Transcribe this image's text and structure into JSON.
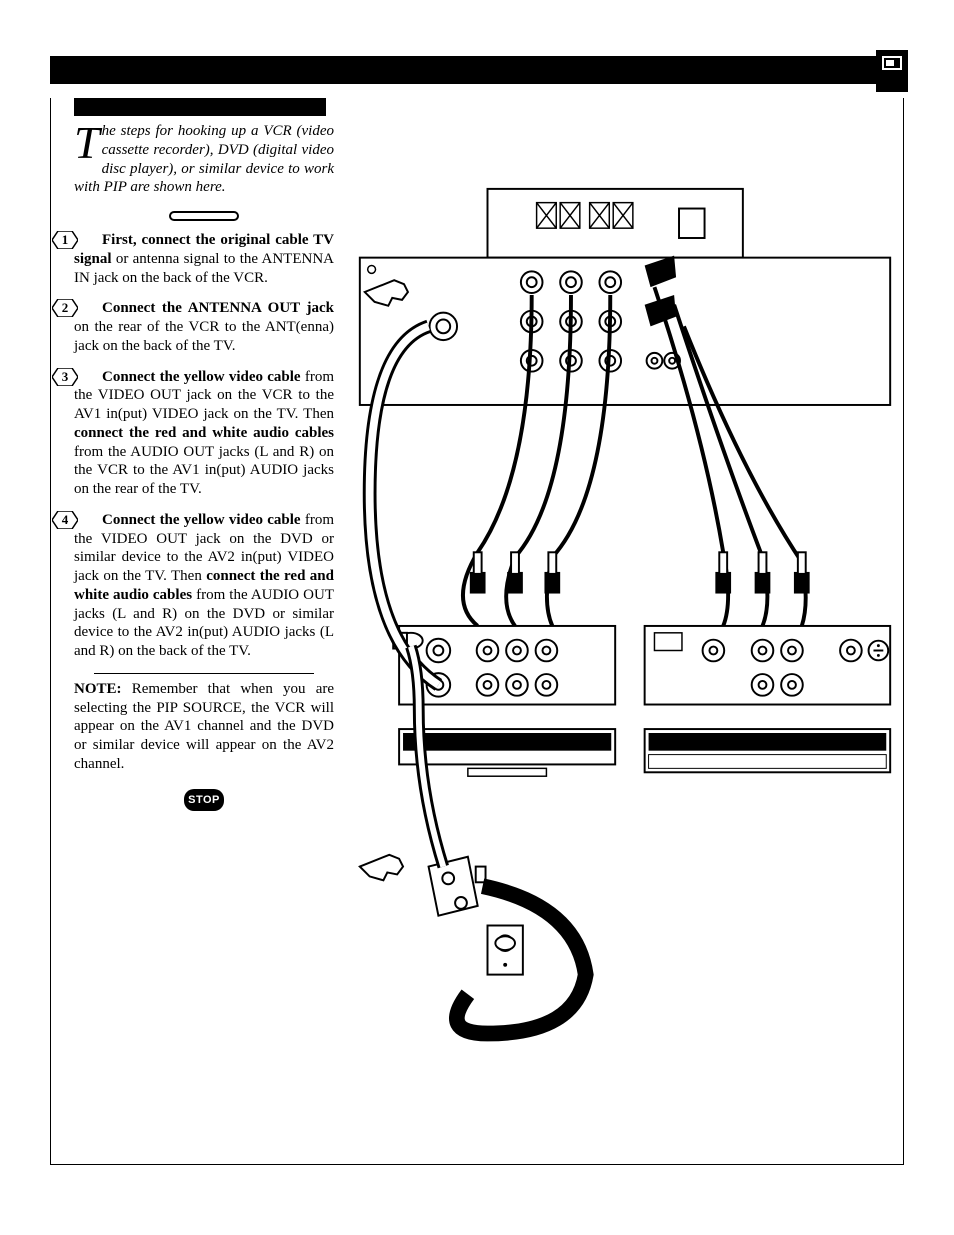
{
  "intro": {
    "dropcap": "T",
    "text": "he steps for hooking up a VCR (video cassette recorder), DVD (digital video disc player), or similar device to work with PIP are shown here."
  },
  "steps": [
    {
      "num": "1",
      "html": "<b>First, connect the original cable TV signal</b> or antenna signal to the ANTENNA IN jack on the back of the VCR."
    },
    {
      "num": "2",
      "html": "<b>Connect the ANTENNA OUT jack</b> on the rear of the VCR to the ANT(enna) jack on the back of the TV."
    },
    {
      "num": "3",
      "html": "<b>Connect the yellow video cable</b> from the VIDEO OUT jack on the VCR to the AV1 in(put) VIDEO jack on the TV.  Then <b>connect the red and white audio cables</b> from the AUDIO OUT jacks (L and R) on the VCR to the AV1 in(put) AUDIO jacks on the rear of the TV."
    },
    {
      "num": "4",
      "html": "<b>Connect the yellow video cable</b> from the VIDEO OUT jack on the DVD or similar device to the AV2 in(put) VIDEO jack on the TV.  Then <b>connect the red and white audio cables</b> from the AUDIO OUT jacks (L and R) on the DVD or similar device to the AV2 in(put) AUDIO jacks (L and R) on the back of the TV."
    }
  ],
  "note": {
    "label": "NOTE:",
    "text": "Remember that when you are selecting the PIP SOURCE, the VCR will appear on the AV1 channel and the DVD or similar device will appear on the AV2 channel."
  },
  "badges": {
    "stop": "STOP"
  }
}
